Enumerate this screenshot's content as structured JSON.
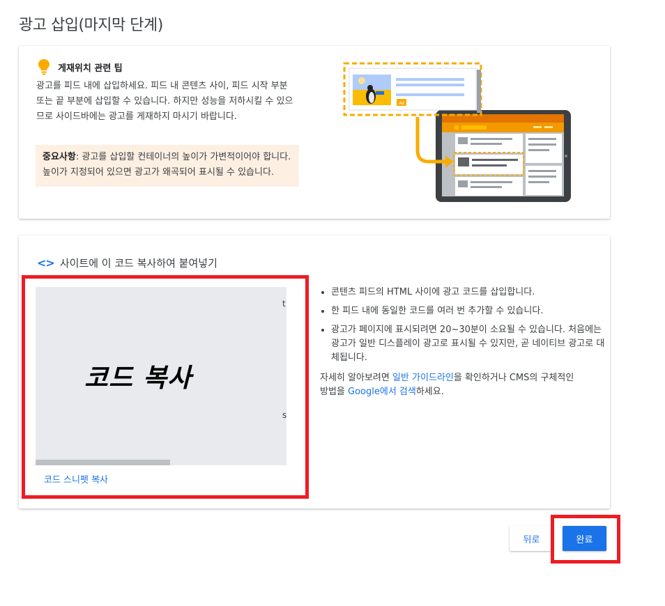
{
  "page": {
    "title": "광고 삽입(마지막 단계)"
  },
  "tips": {
    "heading": "게재위치 관련 팁",
    "body": "광고를 피드 내에 삽입하세요. 피드 내 콘텐츠 사이, 피드 시작 부분 또는 끝 부분에 삽입할 수 있습니다. 하지만 성능을 저하시킬 수 있으므로 사이드바에는 광고를 게재하지 마시기 바랍니다.",
    "important_label": "중요사항",
    "important_text": ": 광고를 삽입할 컨테이너의 높이가 가변적이어야 합니다. 높이가 지정되어 있으면 광고가 왜곡되어 표시될 수 있습니다.",
    "illustration_badge": "Ad",
    "accent_color": "#f9ab00"
  },
  "code": {
    "heading": "사이트에 이 코드 복사하여 붙여넣기",
    "overlay": "코드 복사",
    "char_top": "t",
    "char_bottom": "s",
    "copy_link": "코드 스니펫 복사",
    "bullets": [
      "콘텐츠 피드의 HTML 사이에 광고 코드를 삽입합니다.",
      "한 피드 내에 동일한 코드를 여러 번 추가할 수 있습니다.",
      "광고가 페이지에 표시되려면 20~30분이 소요될 수 있습니다. 처음에는 광고가 일반 디스플레이 광고로 표시될 수 있지만, 곧 네이티브 광고로 대체됩니다."
    ],
    "more_prefix": "자세히 알아보려면 ",
    "more_link1": "일반 가이드라인",
    "more_mid": "을 확인하거나 CMS의 구체적인 방법을 ",
    "more_link2": "Google에서 검색",
    "more_suffix": "하세요."
  },
  "buttons": {
    "back": "뒤로",
    "done": "완료"
  },
  "colors": {
    "primary": "#1a73e8",
    "highlight": "#ed1c24",
    "warning_bg": "#fdefe2"
  }
}
